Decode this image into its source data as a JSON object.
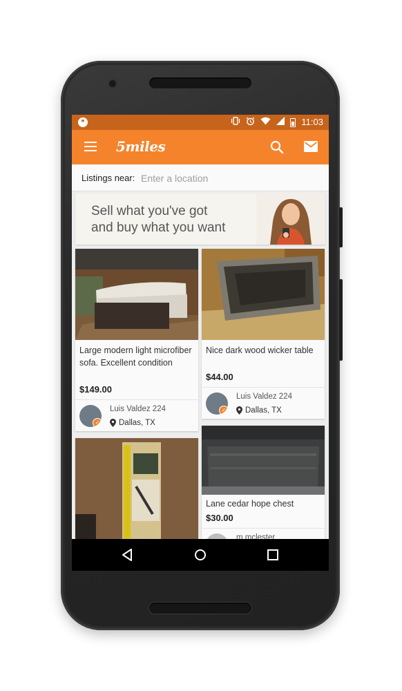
{
  "status_bar": {
    "time": "11:03",
    "icons": [
      "hangouts-icon",
      "vibrate-icon",
      "alarm-icon",
      "wifi-icon",
      "signal-icon",
      "battery-icon"
    ]
  },
  "app_bar": {
    "logo": "5miles",
    "color": "#f5832b"
  },
  "location_bar": {
    "label": "Listings near:",
    "placeholder": "Enter a location",
    "value": ""
  },
  "banner": {
    "line1": "Sell what you've got",
    "line2": "and buy what you want"
  },
  "listings": [
    {
      "title": "Large modern light microfiber sofa. Excellent condition",
      "price": "$149.00",
      "seller": "Luis Valdez 224",
      "location": "Dallas, TX"
    },
    {
      "title": "Nice dark wood wicker table",
      "price": "$44.00",
      "seller": "Luis Valdez 224",
      "location": "Dallas, TX"
    },
    {
      "title": "",
      "price": "",
      "seller": "",
      "location": ""
    },
    {
      "title": "Lane cedar hope chest",
      "price": "$30.00",
      "seller": "m mclester",
      "location": ""
    }
  ],
  "colors": {
    "brand": "#f5832b",
    "status_bar": "#c6641c",
    "background": "#eeeeee"
  }
}
